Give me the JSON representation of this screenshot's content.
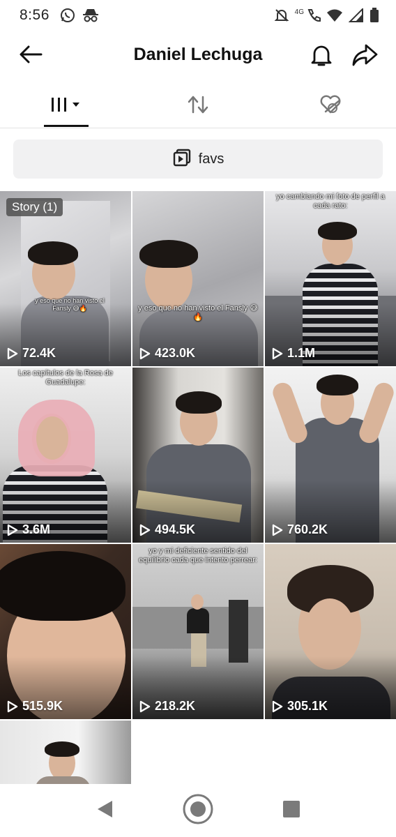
{
  "status_bar": {
    "time": "8:56",
    "network": "4G",
    "icons": [
      "whatsapp-icon",
      "incognito-icon",
      "notifications-muted-icon",
      "volte-call-icon",
      "wifi-icon",
      "signal-icon",
      "battery-icon"
    ]
  },
  "header": {
    "title": "Daniel Lechuga",
    "back_icon": "back-arrow-icon",
    "bell_icon": "bell-icon",
    "share_icon": "share-arrow-icon"
  },
  "tabs": [
    {
      "name": "videos",
      "icon": "grid-lines-dropdown-icon",
      "active": true
    },
    {
      "name": "reposts",
      "icon": "repost-icon",
      "active": false
    },
    {
      "name": "liked",
      "icon": "hidden-heart-icon",
      "active": false
    }
  ],
  "playlist": {
    "label": "favs",
    "icon": "playlist-icon"
  },
  "videos": [
    {
      "views": "72.4K",
      "badge": "Story (1)",
      "caption": "y eso que no han visto el Fansly 😅🔥"
    },
    {
      "views": "423.0K",
      "caption": "y eso que no han visto el Fansly 😅🔥"
    },
    {
      "views": "1.1M",
      "caption": "yo cambiando mi foto de perfil a cada rato:"
    },
    {
      "views": "3.6M",
      "caption": "Los capítulos de la Rosa de Guadalupe:"
    },
    {
      "views": "494.5K",
      "caption": ""
    },
    {
      "views": "760.2K",
      "caption": ""
    },
    {
      "views": "515.9K",
      "caption": ""
    },
    {
      "views": "218.2K",
      "caption": "yo y mi deficiente sentido del equilibrio cada que intento perrear:"
    },
    {
      "views": "305.1K",
      "caption": ""
    },
    {
      "views": "",
      "caption": ""
    }
  ],
  "colors": {
    "accent": "#111111",
    "playlist_bg": "#f1f1f2",
    "divider": "#e3e3e3"
  }
}
